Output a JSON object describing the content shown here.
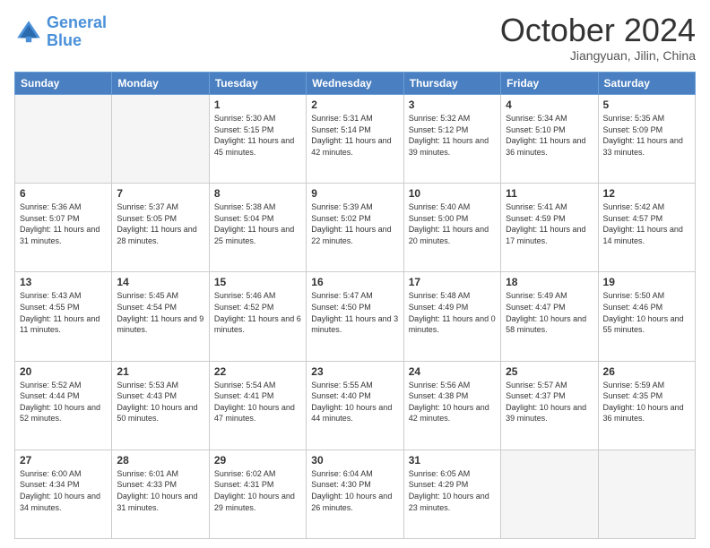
{
  "header": {
    "logo_line1": "General",
    "logo_line2": "Blue",
    "month_title": "October 2024",
    "subtitle": "Jiangyuan, Jilin, China"
  },
  "days_of_week": [
    "Sunday",
    "Monday",
    "Tuesday",
    "Wednesday",
    "Thursday",
    "Friday",
    "Saturday"
  ],
  "weeks": [
    [
      {
        "day": "",
        "info": ""
      },
      {
        "day": "",
        "info": ""
      },
      {
        "day": "1",
        "info": "Sunrise: 5:30 AM\nSunset: 5:15 PM\nDaylight: 11 hours and 45 minutes."
      },
      {
        "day": "2",
        "info": "Sunrise: 5:31 AM\nSunset: 5:14 PM\nDaylight: 11 hours and 42 minutes."
      },
      {
        "day": "3",
        "info": "Sunrise: 5:32 AM\nSunset: 5:12 PM\nDaylight: 11 hours and 39 minutes."
      },
      {
        "day": "4",
        "info": "Sunrise: 5:34 AM\nSunset: 5:10 PM\nDaylight: 11 hours and 36 minutes."
      },
      {
        "day": "5",
        "info": "Sunrise: 5:35 AM\nSunset: 5:09 PM\nDaylight: 11 hours and 33 minutes."
      }
    ],
    [
      {
        "day": "6",
        "info": "Sunrise: 5:36 AM\nSunset: 5:07 PM\nDaylight: 11 hours and 31 minutes."
      },
      {
        "day": "7",
        "info": "Sunrise: 5:37 AM\nSunset: 5:05 PM\nDaylight: 11 hours and 28 minutes."
      },
      {
        "day": "8",
        "info": "Sunrise: 5:38 AM\nSunset: 5:04 PM\nDaylight: 11 hours and 25 minutes."
      },
      {
        "day": "9",
        "info": "Sunrise: 5:39 AM\nSunset: 5:02 PM\nDaylight: 11 hours and 22 minutes."
      },
      {
        "day": "10",
        "info": "Sunrise: 5:40 AM\nSunset: 5:00 PM\nDaylight: 11 hours and 20 minutes."
      },
      {
        "day": "11",
        "info": "Sunrise: 5:41 AM\nSunset: 4:59 PM\nDaylight: 11 hours and 17 minutes."
      },
      {
        "day": "12",
        "info": "Sunrise: 5:42 AM\nSunset: 4:57 PM\nDaylight: 11 hours and 14 minutes."
      }
    ],
    [
      {
        "day": "13",
        "info": "Sunrise: 5:43 AM\nSunset: 4:55 PM\nDaylight: 11 hours and 11 minutes."
      },
      {
        "day": "14",
        "info": "Sunrise: 5:45 AM\nSunset: 4:54 PM\nDaylight: 11 hours and 9 minutes."
      },
      {
        "day": "15",
        "info": "Sunrise: 5:46 AM\nSunset: 4:52 PM\nDaylight: 11 hours and 6 minutes."
      },
      {
        "day": "16",
        "info": "Sunrise: 5:47 AM\nSunset: 4:50 PM\nDaylight: 11 hours and 3 minutes."
      },
      {
        "day": "17",
        "info": "Sunrise: 5:48 AM\nSunset: 4:49 PM\nDaylight: 11 hours and 0 minutes."
      },
      {
        "day": "18",
        "info": "Sunrise: 5:49 AM\nSunset: 4:47 PM\nDaylight: 10 hours and 58 minutes."
      },
      {
        "day": "19",
        "info": "Sunrise: 5:50 AM\nSunset: 4:46 PM\nDaylight: 10 hours and 55 minutes."
      }
    ],
    [
      {
        "day": "20",
        "info": "Sunrise: 5:52 AM\nSunset: 4:44 PM\nDaylight: 10 hours and 52 minutes."
      },
      {
        "day": "21",
        "info": "Sunrise: 5:53 AM\nSunset: 4:43 PM\nDaylight: 10 hours and 50 minutes."
      },
      {
        "day": "22",
        "info": "Sunrise: 5:54 AM\nSunset: 4:41 PM\nDaylight: 10 hours and 47 minutes."
      },
      {
        "day": "23",
        "info": "Sunrise: 5:55 AM\nSunset: 4:40 PM\nDaylight: 10 hours and 44 minutes."
      },
      {
        "day": "24",
        "info": "Sunrise: 5:56 AM\nSunset: 4:38 PM\nDaylight: 10 hours and 42 minutes."
      },
      {
        "day": "25",
        "info": "Sunrise: 5:57 AM\nSunset: 4:37 PM\nDaylight: 10 hours and 39 minutes."
      },
      {
        "day": "26",
        "info": "Sunrise: 5:59 AM\nSunset: 4:35 PM\nDaylight: 10 hours and 36 minutes."
      }
    ],
    [
      {
        "day": "27",
        "info": "Sunrise: 6:00 AM\nSunset: 4:34 PM\nDaylight: 10 hours and 34 minutes."
      },
      {
        "day": "28",
        "info": "Sunrise: 6:01 AM\nSunset: 4:33 PM\nDaylight: 10 hours and 31 minutes."
      },
      {
        "day": "29",
        "info": "Sunrise: 6:02 AM\nSunset: 4:31 PM\nDaylight: 10 hours and 29 minutes."
      },
      {
        "day": "30",
        "info": "Sunrise: 6:04 AM\nSunset: 4:30 PM\nDaylight: 10 hours and 26 minutes."
      },
      {
        "day": "31",
        "info": "Sunrise: 6:05 AM\nSunset: 4:29 PM\nDaylight: 10 hours and 23 minutes."
      },
      {
        "day": "",
        "info": ""
      },
      {
        "day": "",
        "info": ""
      }
    ]
  ]
}
